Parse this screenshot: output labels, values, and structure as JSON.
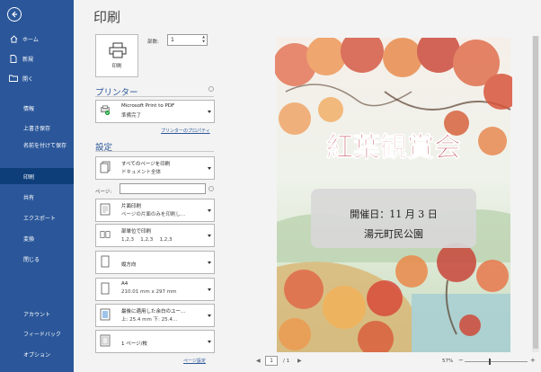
{
  "sidebar": {
    "items": [
      {
        "label": "ホーム",
        "icon": "home-icon"
      },
      {
        "label": "新規",
        "icon": "new-document-icon"
      },
      {
        "label": "開く",
        "icon": "folder-icon"
      },
      {
        "label": "情報"
      },
      {
        "label": "上書き保存"
      },
      {
        "label": "名前を付けて保存"
      },
      {
        "label": "印刷"
      },
      {
        "label": "共有"
      },
      {
        "label": "エクスポート"
      },
      {
        "label": "変換"
      },
      {
        "label": "閉じる"
      }
    ],
    "bottom": [
      {
        "label": "アカウント"
      },
      {
        "label": "フィードバック"
      },
      {
        "label": "オプション"
      }
    ],
    "active": "印刷",
    "colors": {
      "bg": "#2b579a",
      "active": "#0e3e7a"
    }
  },
  "main": {
    "title": "印刷",
    "print_button": "印刷",
    "copies_label": "部数:",
    "copies_value": "1",
    "printer_header": "プリンター",
    "printer_name": "Microsoft Print to PDF",
    "printer_status": "準備完了",
    "printer_properties": "プリンターのプロパティ",
    "settings_header": "設定",
    "settings": [
      {
        "line1": "すべてのページを印刷",
        "line2": "ドキュメント全体",
        "icon": "pages-icon"
      },
      {
        "line1": "片面印刷",
        "line2": "ページの片面のみを印刷し...",
        "icon": "one-sided-icon"
      },
      {
        "line1": "部単位で印刷",
        "line2": "1,2,3　 1,2,3　 1,2,3",
        "icon": "collated-icon"
      },
      {
        "line1": "縦方向",
        "icon": "portrait-icon"
      },
      {
        "line1": "A4",
        "line2": "210.01 mm x 297 mm",
        "icon": "paper-size-icon"
      },
      {
        "line1": "最後に適用した余白のユー...",
        "line2": "上: 25.4 mm 下: 25.4...",
        "icon": "margins-icon"
      },
      {
        "line1": "1 ページ/枚",
        "icon": "pages-per-sheet-icon"
      }
    ],
    "pages_label": "ページ:",
    "pages_value": "",
    "page_setup_link": "ページ設定"
  },
  "preview": {
    "poster_title": "紅葉観賞会",
    "date_line": "開催日：11 月 3 日",
    "place_line": "湯元町民公園",
    "current_page": "1",
    "total_pages": "/ 1",
    "zoom": "57%",
    "colors": {
      "title": "#b01020",
      "box": "#d8d8d8"
    }
  }
}
